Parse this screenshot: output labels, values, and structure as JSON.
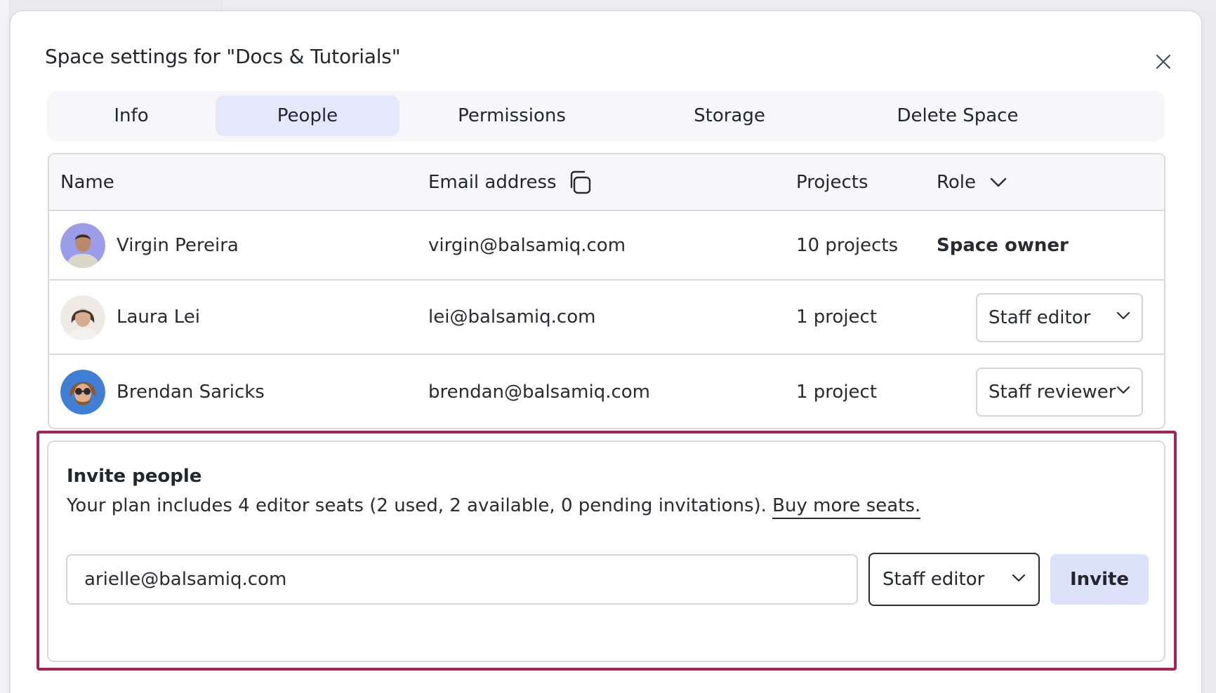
{
  "dialog": {
    "title": "Space settings for \"Docs & Tutorials\"",
    "close_icon": "close-icon"
  },
  "tabs": [
    {
      "label": "Info",
      "active": false
    },
    {
      "label": "People",
      "active": true
    },
    {
      "label": "Permissions",
      "active": false
    },
    {
      "label": "Storage",
      "active": false
    },
    {
      "label": "Delete Space",
      "active": false
    }
  ],
  "table": {
    "headers": {
      "name": "Name",
      "email": "Email address",
      "email_icon": "copy-icon",
      "projects": "Projects",
      "role": "Role",
      "role_icon": "chevron-down-icon"
    },
    "rows": [
      {
        "name": "Virgin Pereira",
        "email": "virgin@balsamiq.com",
        "projects": "10 projects",
        "role": "Space owner",
        "editable": false
      },
      {
        "name": "Laura Lei",
        "email": "lei@balsamiq.com",
        "projects": "1 project",
        "role": "Staff editor",
        "editable": true
      },
      {
        "name": "Brendan Saricks",
        "email": "brendan@balsamiq.com",
        "projects": "1 project",
        "role": "Staff reviewer",
        "editable": true
      }
    ]
  },
  "invite": {
    "title": "Invite people",
    "description": "Your plan includes 4 editor seats (2 used, 2 available, 0 pending invitations).",
    "link_label": "Buy more seats.",
    "email_value": "arielle@balsamiq.com",
    "role_value": "Staff editor",
    "button_label": "Invite"
  },
  "colors": {
    "accent_tab": "#e5e8fb",
    "invite_button": "#dde2fb",
    "highlight_border": "#a3245a"
  }
}
